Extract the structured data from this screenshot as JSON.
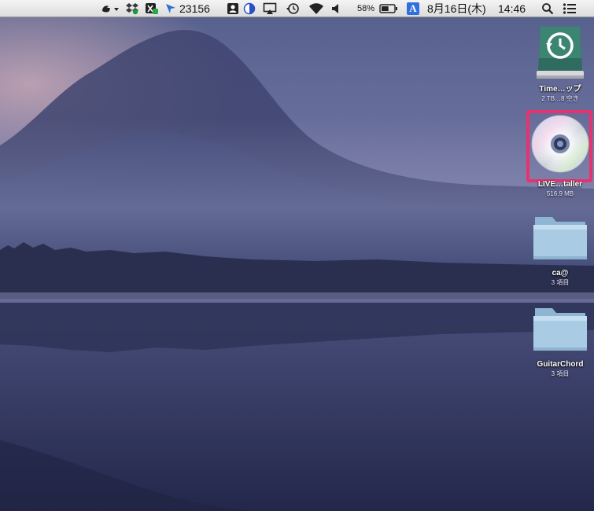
{
  "menubar": {
    "extras_icons": [
      "bird-icon",
      "dropbox-icon",
      "app-badge-icon",
      "location-arrow-icon"
    ],
    "counter": "23156",
    "status_icons": [
      "contact-icon",
      "contrast-icon",
      "airplay-icon",
      "time-machine-icon",
      "wifi-icon",
      "volume-icon"
    ],
    "battery_percent": "58%",
    "battery_level": 0.58,
    "input_method": "A",
    "date": "8月16日(木)",
    "time": "14:46",
    "right_icons": [
      "spotlight-search-icon",
      "notification-center-icon"
    ]
  },
  "desktop": {
    "items": [
      {
        "icon": "time-machine-drive-icon",
        "label": "Time…ップ",
        "sub": "2 TB…8 空き"
      },
      {
        "icon": "disk-image-icon",
        "label": "LIVE…taller",
        "sub": "516.9 MB"
      },
      {
        "icon": "folder-icon",
        "label": "ca@",
        "sub": "3 項目"
      },
      {
        "icon": "folder-icon",
        "label": "GuitarChord",
        "sub": "3 項目"
      }
    ]
  },
  "colors": {
    "highlight": "#e8326e",
    "folder": "#a9cce4",
    "sky": "#5f6a98",
    "water": "#2c3154"
  }
}
